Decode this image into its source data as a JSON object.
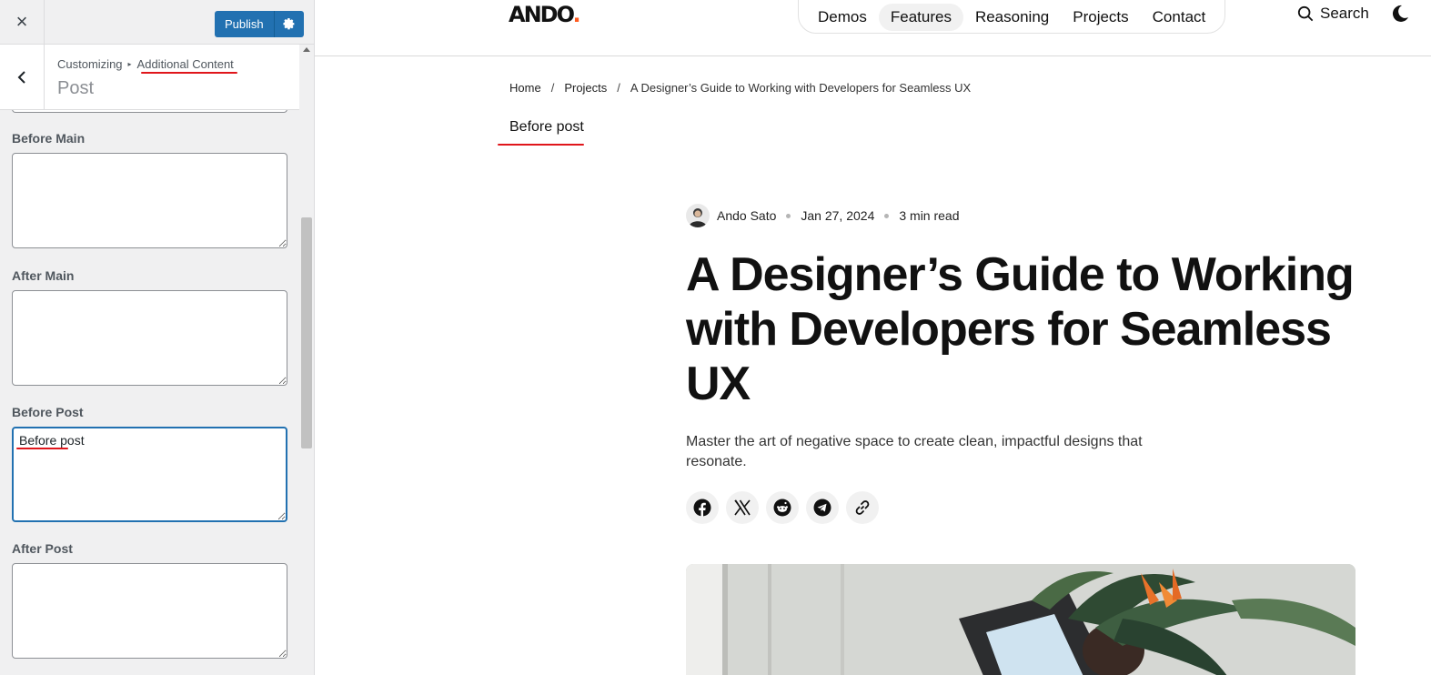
{
  "customizer": {
    "close_label": "×",
    "publish_label": "Publish",
    "breadcrumb": {
      "parent": "Customizing",
      "current": "Additional Content"
    },
    "section_title": "Post",
    "fields": [
      {
        "label": "Before Main",
        "value": ""
      },
      {
        "label": "After Main",
        "value": ""
      },
      {
        "label": "Before Post",
        "value": "Before post"
      },
      {
        "label": "After Post",
        "value": ""
      }
    ]
  },
  "site": {
    "logo_text": "ANDO",
    "logo_dot": ".",
    "nav": [
      {
        "label": "Demos"
      },
      {
        "label": "Features"
      },
      {
        "label": "Reasoning"
      },
      {
        "label": "Projects"
      },
      {
        "label": "Contact"
      }
    ],
    "search_label": "Search",
    "breadcrumb": [
      "Home",
      "Projects",
      "A Designer’s Guide to Working with Developers for Seamless UX"
    ],
    "breadcrumb_sep": "/",
    "before_post_output": "Before post",
    "post": {
      "author": "Ando Sato",
      "date": "Jan 27, 2024",
      "read_time": "3 min read",
      "title": "A Designer’s Guide to Working with Developers for Seamless UX",
      "excerpt": "Master the art of negative space to create clean, impactful designs that resonate."
    },
    "share_icons": [
      "facebook-icon",
      "x-icon",
      "reddit-icon",
      "telegram-icon",
      "link-icon"
    ]
  },
  "colors": {
    "accent": "#2271b1",
    "annotation": "#e0161b",
    "logo_accent": "#ff5a1f"
  }
}
